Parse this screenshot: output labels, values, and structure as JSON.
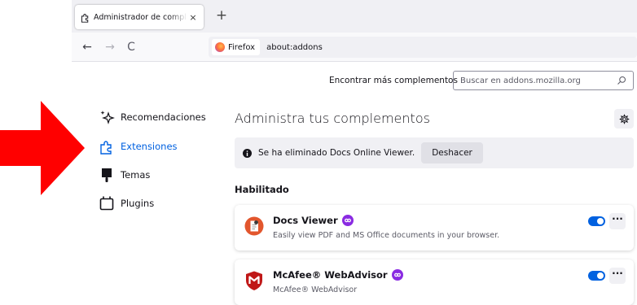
{
  "browser": {
    "tab": {
      "title": "Administrador de complementos",
      "close_glyph": "×"
    },
    "new_tab_glyph": "+",
    "nav": {
      "back_glyph": "←",
      "forward_glyph": "→",
      "reload_glyph": "C"
    },
    "urlbar": {
      "identity_label": "Firefox",
      "url": "about:addons"
    }
  },
  "header": {
    "find_more_label": "Encontrar más complementos",
    "search_placeholder": "Buscar en addons.mozilla.org"
  },
  "sidebar": {
    "items": [
      {
        "label": "Recomendaciones",
        "icon": "sparkle-icon"
      },
      {
        "label": "Extensiones",
        "icon": "puzzle-icon",
        "active": true
      },
      {
        "label": "Temas",
        "icon": "brush-icon"
      },
      {
        "label": "Plugins",
        "icon": "plugin-icon"
      }
    ]
  },
  "main": {
    "title": "Administra tus complementos",
    "notice": {
      "message": "Se ha eliminado Docs Online Viewer.",
      "undo_label": "Deshacer"
    },
    "section_heading": "Habilitado",
    "addons": [
      {
        "name": "Docs Viewer",
        "description": "Easily view PDF and MS Office documents in your browser.",
        "enabled": true,
        "more_glyph": "···"
      },
      {
        "name": "McAfee® WebAdvisor",
        "description": "McAfee® WebAdvisor",
        "enabled": true,
        "more_glyph": "···"
      }
    ]
  },
  "colors": {
    "accent": "#0061e0",
    "arrow": "#ff0000",
    "badge": "#8a2be2",
    "mcafee": "#c01818"
  }
}
